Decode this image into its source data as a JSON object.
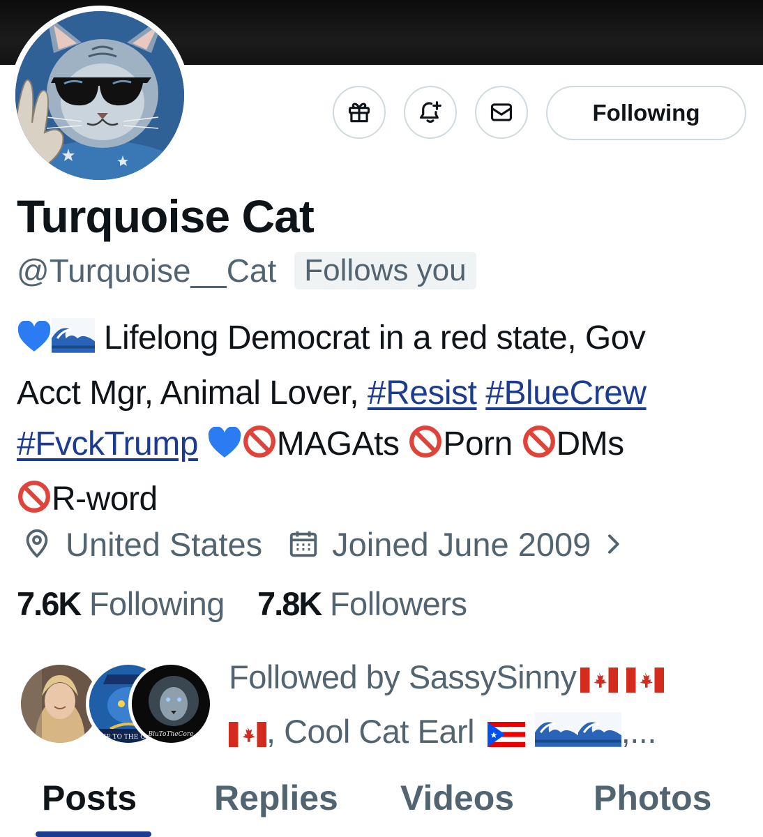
{
  "header": {
    "action_buttons": [
      {
        "icon": "gift-icon"
      },
      {
        "icon": "notification-bell-plus-icon"
      },
      {
        "icon": "message-envelope-icon"
      }
    ],
    "follow_button_label": "Following"
  },
  "profile": {
    "display_name": "Turquoise Cat",
    "handle": "@Turquoise__Cat",
    "follows_you_badge": "Follows you",
    "bio": {
      "line1_text": " Lifelong Democrat in a red state, Gov",
      "line2_text": "Acct Mgr, Animal Lover, ",
      "hashtag_resist": "#Resist",
      "hashtag_bluecrew": "#BlueCrew",
      "hashtag_fvcktrump": "#FvckTrump",
      "item_magats": "MAGAts ",
      "item_porn": "Porn ",
      "item_dms": "DMs",
      "item_rword": "R-word"
    },
    "location": "United States",
    "joined": "Joined June 2009",
    "following_count": "7.6K",
    "following_label": " Following",
    "followers_count": "7.8K",
    "followers_label": " Followers"
  },
  "followed_by": {
    "line1": "Followed by SassySinny",
    "line2_sep": ", Cool Cat Earl ",
    "ellipsis": ",...",
    "avatar_text_2": "LUE TO THE CORE",
    "avatar_text_3": "BluToTheCore"
  },
  "tabs": [
    {
      "label": "Posts",
      "active": true
    },
    {
      "label": "Replies",
      "active": false
    },
    {
      "label": "Videos",
      "active": false
    },
    {
      "label": "Photos",
      "active": false
    }
  ],
  "colors": {
    "accent": "#1d3b8f",
    "secondary_text": "#536471",
    "primary_text": "#0f1419",
    "border": "#cfd9de"
  }
}
